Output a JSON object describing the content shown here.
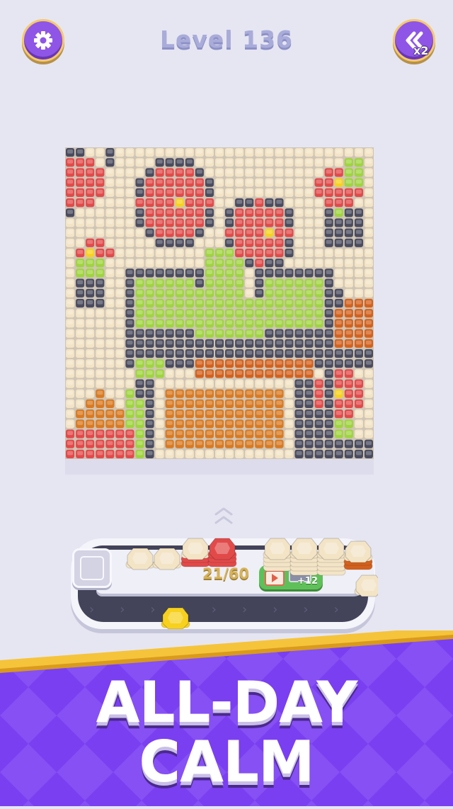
{
  "level_title": "Level 136",
  "speed_multiplier": "x2",
  "counter_text": "21/60",
  "ad_reward_label": "+12",
  "tagline": {
    "line1": "ALL-DAY",
    "line2": "CALM"
  },
  "colors": {
    "purple": "#8f55e6",
    "gold_border": "#f5c96a",
    "banner_purple": "#7a3ff0",
    "banner_stripe": "#f5c43a",
    "bead_cream": "#f3e4c6",
    "bead_red": "#e24a4a",
    "bead_dark": "#4a4b5e",
    "bead_green": "#9fd43f",
    "bead_orange": "#d97a22",
    "bead_brown": "#d3611d",
    "bead_yellow": "#f7d11e"
  }
}
